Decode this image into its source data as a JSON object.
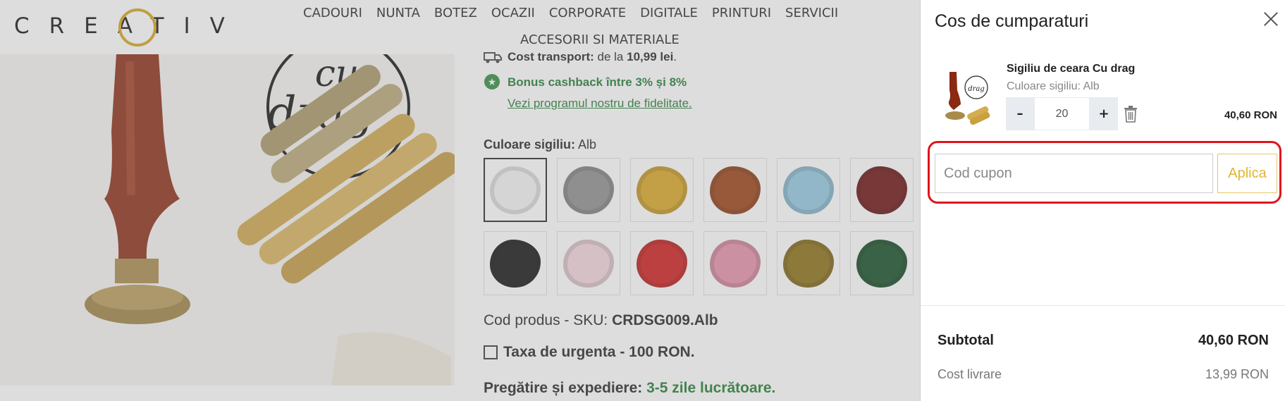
{
  "header": {
    "logo_text": "CREATIV",
    "nav": [
      "CADOURI",
      "NUNTA",
      "BOTEZ",
      "OCAZII",
      "CORPORATE",
      "DIGITALE",
      "PRINTURI",
      "SERVICII",
      "ACCESORII SI MATERIALE"
    ]
  },
  "product_image": {
    "stamp_text_1": "cu",
    "stamp_text_2": "drag"
  },
  "product_info": {
    "shipping_label": "Cost transport:",
    "shipping_from": "de la",
    "shipping_value": "10,99 lei",
    "bonus_text": "Bonus cashback între 3% și 8%",
    "fidelity_link": "Vezi programul nostru de fidelitate.",
    "color_label": "Culoare sigiliu:",
    "color_value": "Alb",
    "swatch_colors": [
      "#f4f4f4",
      "#8c8c8c",
      "#d9a520",
      "#9a3d10",
      "#8fc7e0",
      "#6a0d0d",
      "#101010",
      "#f3d6dc",
      "#d01818",
      "#e58fa8",
      "#8a6d10",
      "#0f4a22"
    ],
    "sku_label": "Cod produs - SKU:",
    "sku_value": "CRDSG009.Alb",
    "urgent_label": "Taxa de urgenta - 100 RON.",
    "prep_label": "Pregătire și expediere:",
    "prep_value": "3-5 zile lucrătoare."
  },
  "cart": {
    "title": "Cos de cumparaturi",
    "item": {
      "name": "Sigiliu de ceara Cu drag",
      "variant": "Culoare sigiliu: Alb",
      "quantity": "20",
      "price": "40,60 RON",
      "minus_label": "–",
      "plus_label": "+"
    },
    "coupon": {
      "placeholder": "Cod cupon",
      "apply_label": "Aplica"
    },
    "summary": {
      "subtotal_label": "Subtotal",
      "subtotal_value": "40,60 RON",
      "delivery_label": "Cost livrare",
      "delivery_value": "13,99 RON"
    }
  }
}
